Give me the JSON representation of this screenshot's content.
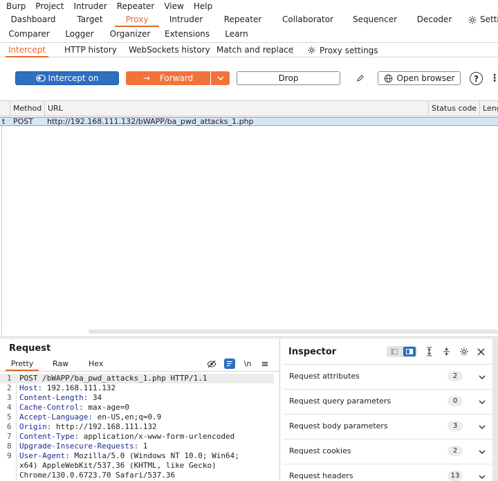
{
  "menubar": [
    "Burp",
    "Project",
    "Intruder",
    "Repeater",
    "View",
    "Help"
  ],
  "main_tabs_row1": [
    "Dashboard",
    "Target",
    "Proxy",
    "Intruder",
    "Repeater",
    "Collaborator",
    "Sequencer",
    "Decoder",
    "Settings"
  ],
  "main_tabs_row2": [
    "Comparer",
    "Logger",
    "Organizer",
    "Extensions",
    "Learn"
  ],
  "proxy_tabs": [
    "Intercept",
    "HTTP history",
    "WebSockets history",
    "Match and replace",
    "Proxy settings"
  ],
  "toolbar": {
    "intercept_label": "Intercept on",
    "forward_label": "Forward",
    "drop_label": "Drop",
    "open_browser_label": "Open browser"
  },
  "table": {
    "columns": [
      "Method",
      "URL",
      "Status code",
      "Length"
    ],
    "rows": [
      {
        "prefix": "t",
        "method": "POST",
        "url": "http://192.168.111.132/bWAPP/ba_pwd_attacks_1.php"
      }
    ]
  },
  "request": {
    "title": "Request",
    "tabs": [
      "Pretty",
      "Raw",
      "Hex"
    ],
    "newline_toggle": "\\n",
    "lines": [
      {
        "n": "1",
        "key": "",
        "val": "POST /bWAPP/ba_pwd_attacks_1.php HTTP/1.1"
      },
      {
        "n": "2",
        "key": "Host:",
        "val": " 192.168.111.132"
      },
      {
        "n": "3",
        "key": "Content-Length:",
        "val": " 34"
      },
      {
        "n": "4",
        "key": "Cache-Control:",
        "val": " max-age=0"
      },
      {
        "n": "5",
        "key": "Accept-Language:",
        "val": " en-US,en;q=0.9"
      },
      {
        "n": "6",
        "key": "Origin:",
        "val": " http://192.168.111.132"
      },
      {
        "n": "7",
        "key": "Content-Type:",
        "val": " application/x-www-form-urlencoded"
      },
      {
        "n": "8",
        "key": "Upgrade-Insecure-Requests:",
        "val": " 1"
      },
      {
        "n": "9",
        "key": "User-Agent:",
        "val": " Mozilla/5.0 (Windows NT 10.0; Win64;"
      },
      {
        "n": "",
        "key": "",
        "val": "x64) AppleWebKit/537.36 (KHTML, like Gecko)"
      },
      {
        "n": "",
        "key": "",
        "val": "Chrome/130.0.6723.70 Safari/537.36"
      }
    ]
  },
  "inspector": {
    "title": "Inspector",
    "sections": [
      {
        "label": "Request attributes",
        "count": "2"
      },
      {
        "label": "Request query parameters",
        "count": "0"
      },
      {
        "label": "Request body parameters",
        "count": "3"
      },
      {
        "label": "Request cookies",
        "count": "2"
      },
      {
        "label": "Request headers",
        "count": "13"
      }
    ]
  },
  "colors": {
    "accent": "#e8672c",
    "intercept_blue": "#2e6fbf",
    "forward_orange": "#f2733a",
    "selection": "#d6e4f5"
  }
}
